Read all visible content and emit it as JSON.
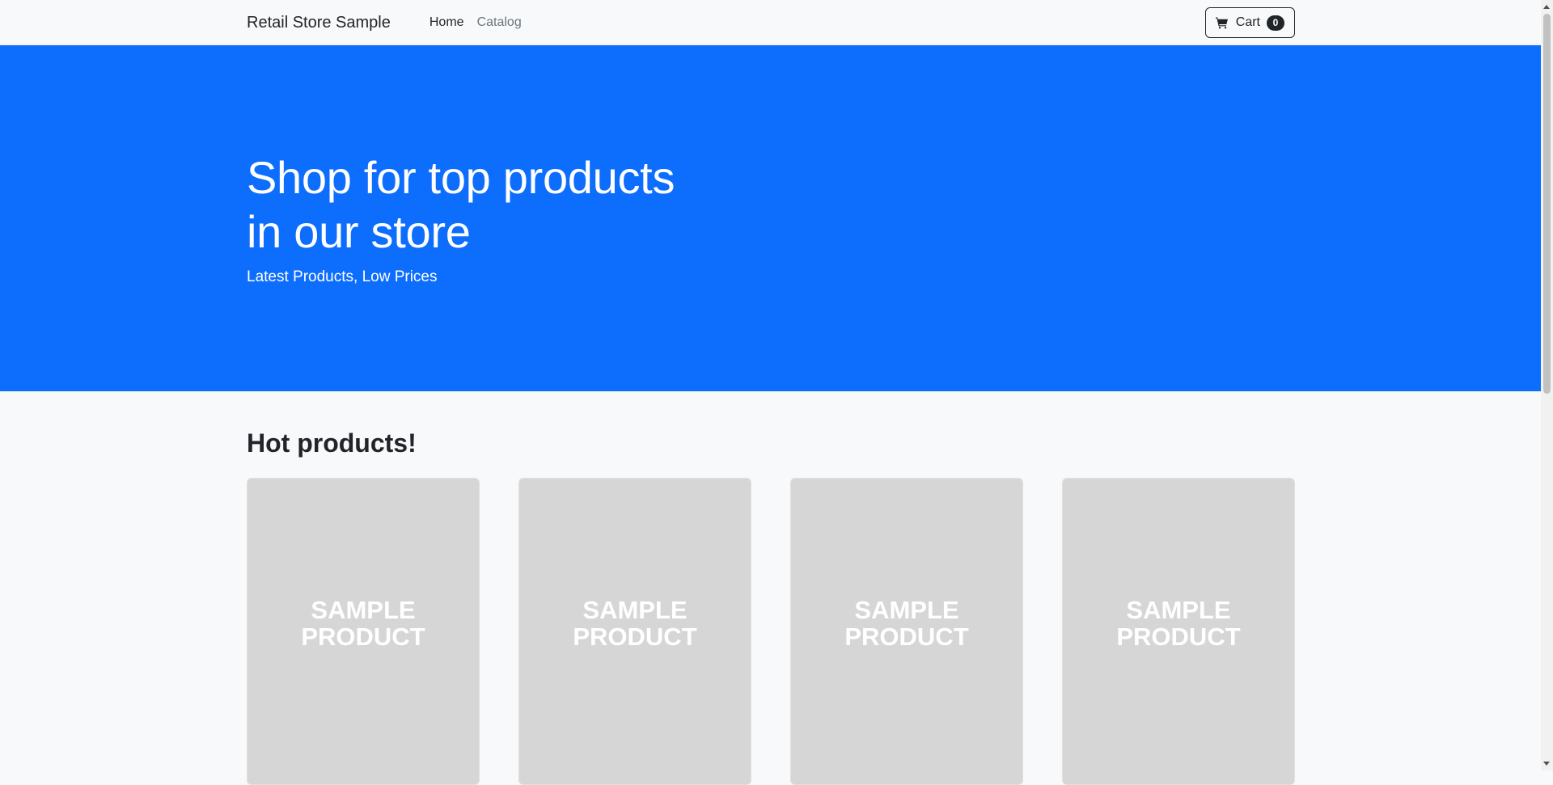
{
  "navbar": {
    "brand": "Retail Store Sample",
    "links": [
      {
        "label": "Home",
        "state": "active"
      },
      {
        "label": "Catalog",
        "state": "inactive"
      }
    ],
    "cart": {
      "label": "Cart",
      "count": "0",
      "icon": "cart-icon"
    }
  },
  "hero": {
    "title_line1": "Shop for top products",
    "title_line2": "in our store",
    "subtitle": "Latest Products, Low Prices",
    "background_color": "#0d6efd"
  },
  "hot_products": {
    "title": "Hot products!",
    "cards": [
      {
        "image_text": "SAMPLE\nPRODUCT"
      },
      {
        "image_text": "SAMPLE\nPRODUCT"
      },
      {
        "image_text": "SAMPLE\nPRODUCT"
      },
      {
        "image_text": "SAMPLE\nPRODUCT"
      }
    ]
  }
}
